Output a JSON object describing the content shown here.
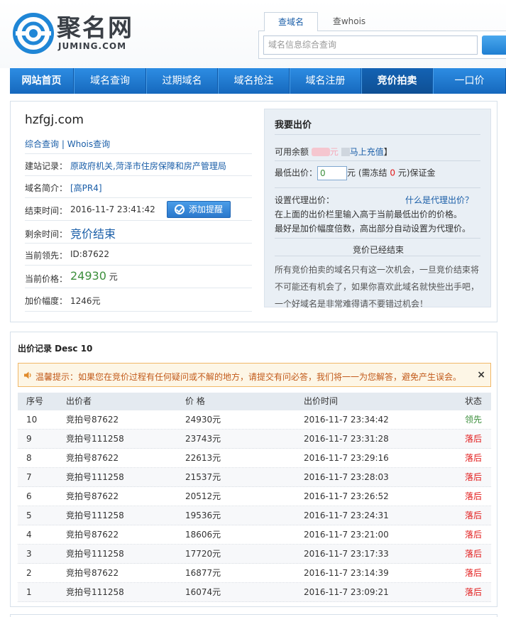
{
  "header": {
    "logo_text": "聚名网",
    "logo_sub": "JUMING.COM",
    "search_tabs": [
      "查域名",
      "查whois"
    ],
    "search_placeholder": "域名信息综合查询"
  },
  "nav": {
    "items": [
      "网站首页",
      "域名查询",
      "过期域名",
      "域名抢注",
      "域名注册",
      "竞价拍卖",
      "一口价"
    ],
    "active": "竞价拍卖"
  },
  "domain": {
    "name": "hzfgj.com",
    "links": [
      "综合查询",
      "Whois查询"
    ],
    "link_sep": "|",
    "record_label": "建站记录：",
    "record_value": "原政府机关,菏泽市住房保障和房产管理局",
    "intro_label": "域名简介：",
    "intro_value": "[高PR4]",
    "end_label": "结束时间：",
    "end_value": "2016-11-7 23:41:42",
    "remind_button": "添加提醒",
    "remain_label": "剩余时间：",
    "remain_value": "竞价结束",
    "leader_label": "当前领先：",
    "leader_value": "ID:87622",
    "price_label": "当前价格：",
    "price_value": "24930",
    "price_unit": "元",
    "increment_label": "加价幅度：",
    "increment_value": "1246元"
  },
  "bid_panel": {
    "title": "我要出价",
    "balance_label": "可用余额",
    "balance_mid": "元",
    "recharge": "马上充值",
    "recharge_close": "】",
    "min_label": "最低出价：",
    "min_value": "0",
    "min_suffix_a": "元 (需冻结",
    "freeze_value": "0",
    "min_suffix_b": "元)保证金",
    "proxy_label": "设置代理出价：",
    "proxy_help": "什么是代理出价？",
    "proxy_note1": "在上面的出价栏里输入高于当前最低出价的价格。",
    "proxy_note2": "最好是加价幅度倍数，高出部分自动设置为代理价。",
    "ended_title": "竞价已经结束",
    "ended_p1": "所有竞价拍卖的域名只有这一次机会，一旦竞价结束将",
    "ended_p2": "不可能还有机会了，如果你喜欢此域名就快些出手吧，",
    "ended_p3": "一个好域名是非常难得请不要错过机会！"
  },
  "records": {
    "title": "出价记录 Desc 10",
    "tip": "温馨提示：如果您在竞价过程有任何疑问或不解的地方，请提交有问必答，我们将一一为您解答，避免产生误会。",
    "close": "×",
    "columns": [
      "序号",
      "出价者",
      "价 格",
      "出价时间",
      "状态"
    ],
    "rows": [
      {
        "no": "10",
        "bidder": "竞拍号87622",
        "price": "24930元",
        "time": "2016-11-7 23:34:42",
        "status": "领先"
      },
      {
        "no": "9",
        "bidder": "竞拍号111258",
        "price": "23743元",
        "time": "2016-11-7 23:31:28",
        "status": "落后"
      },
      {
        "no": "8",
        "bidder": "竞拍号87622",
        "price": "22613元",
        "time": "2016-11-7 23:29:16",
        "status": "落后"
      },
      {
        "no": "7",
        "bidder": "竞拍号111258",
        "price": "21537元",
        "time": "2016-11-7 23:28:03",
        "status": "落后"
      },
      {
        "no": "6",
        "bidder": "竞拍号87622",
        "price": "20512元",
        "time": "2016-11-7 23:26:52",
        "status": "落后"
      },
      {
        "no": "5",
        "bidder": "竞拍号111258",
        "price": "19536元",
        "time": "2016-11-7 23:24:31",
        "status": "落后"
      },
      {
        "no": "4",
        "bidder": "竞拍号87622",
        "price": "18606元",
        "time": "2016-11-7 23:21:00",
        "status": "落后"
      },
      {
        "no": "3",
        "bidder": "竞拍号111258",
        "price": "17720元",
        "time": "2016-11-7 23:17:33",
        "status": "落后"
      },
      {
        "no": "2",
        "bidder": "竞拍号87622",
        "price": "16877元",
        "time": "2016-11-7 23:14:39",
        "status": "落后"
      },
      {
        "no": "1",
        "bidder": "竞拍号111258",
        "price": "16074元",
        "time": "2016-11-7 23:09:21",
        "status": "落后"
      }
    ]
  }
}
